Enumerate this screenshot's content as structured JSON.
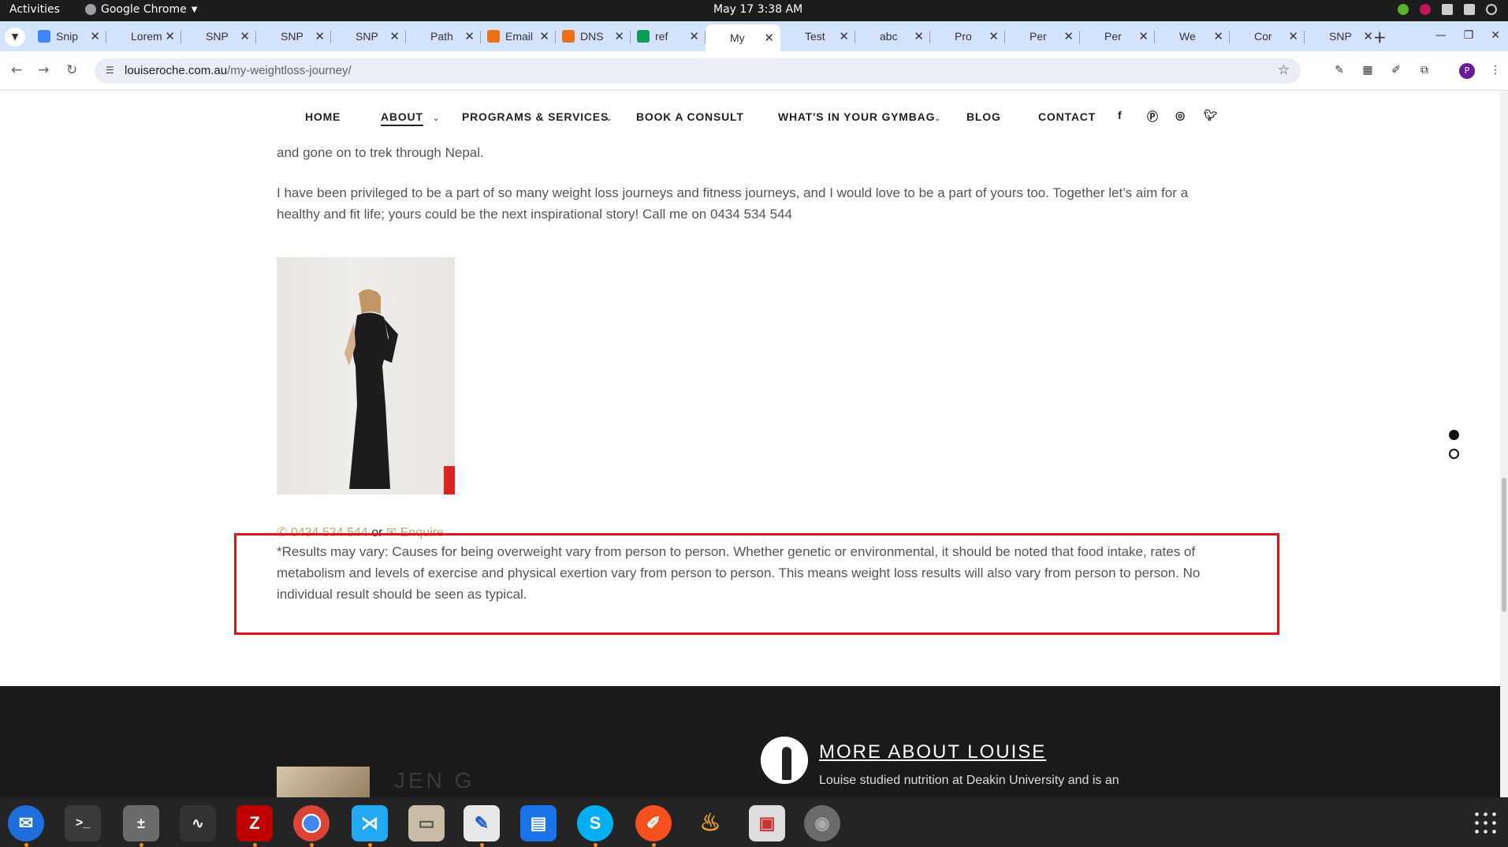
{
  "system": {
    "activities": "Activities",
    "app_name": "Google Chrome",
    "clock": "May 17  3:38 AM"
  },
  "tabs": [
    {
      "title": "Snip",
      "icon": "docs-icon",
      "color": "#4285f4"
    },
    {
      "title": "Lorem",
      "icon": "L-icon",
      "color": "#d3e3fd"
    },
    {
      "title": "SNP",
      "icon": "snp-icon",
      "color": "#d3e3fd"
    },
    {
      "title": "SNP",
      "icon": "snp-icon",
      "color": "#d3e3fd"
    },
    {
      "title": "SNP",
      "icon": "snp-icon",
      "color": "#d3e3fd"
    },
    {
      "title": "Path",
      "icon": "snp-icon",
      "color": "#d3e3fd"
    },
    {
      "title": "Email",
      "icon": "email-icon",
      "color": "#e8711c"
    },
    {
      "title": "DNS",
      "icon": "dns-icon",
      "color": "#e8711c"
    },
    {
      "title": "ref",
      "icon": "sheets-icon",
      "color": "#0f9d58"
    },
    {
      "title": "My",
      "icon": "lr-icon",
      "color": "#ffffff",
      "active": true
    },
    {
      "title": "Test",
      "icon": "lr-icon",
      "color": "#d3e3fd"
    },
    {
      "title": "abc",
      "icon": "lr-icon",
      "color": "#d3e3fd"
    },
    {
      "title": "Pro",
      "icon": "lr-icon",
      "color": "#d3e3fd"
    },
    {
      "title": "Per",
      "icon": "lr-icon",
      "color": "#d3e3fd"
    },
    {
      "title": "Per",
      "icon": "lr-icon",
      "color": "#d3e3fd"
    },
    {
      "title": "We",
      "icon": "lr-icon",
      "color": "#d3e3fd"
    },
    {
      "title": "Cor",
      "icon": "lr-icon",
      "color": "#d3e3fd"
    },
    {
      "title": "SNP",
      "icon": "snp-icon",
      "color": "#d3e3fd"
    }
  ],
  "toolbar": {
    "url_domain": "louiseroche.com.au",
    "url_path": "/my-weightloss-journey/",
    "profile_initial": "P"
  },
  "sitenav": {
    "home": "HOME",
    "about": "ABOUT",
    "programs": "PROGRAMS & SERVICES",
    "book": "BOOK A CONSULT",
    "gymbag": "WHAT'S IN YOUR GYMBAG",
    "blog": "BLOG",
    "contact": "CONTACT"
  },
  "content": {
    "p1": "and gone on to trek through Nepal.",
    "p2": "I have been privileged to be a part of so many weight loss journeys and fitness journeys, and I would love to be a part of yours too. Together let’s aim for a healthy and fit life; yours could be the next inspirational story!  Call me on 0434 534 544",
    "phone": "0434 534 544",
    "or": "or",
    "enquire": "Enquire",
    "disclaimer": "*Results may vary: Causes for being overweight vary from person to person. Whether genetic or environmental, it should be noted that food intake, rates of metabolism and levels of exercise and physical exertion vary from person to person. This means weight loss results will also vary from person to person. No individual result should be seen as typical."
  },
  "footer": {
    "author_name": "JEN G",
    "author_text": "",
    "more_heading": "MORE ABOUT LOUISE",
    "more_text": "Louise studied nutrition at Deakin University and is an"
  },
  "colors": {
    "highlight": "#e0141a",
    "link_gold": "#c5a877",
    "tabstrip": "#d3e3fd"
  }
}
